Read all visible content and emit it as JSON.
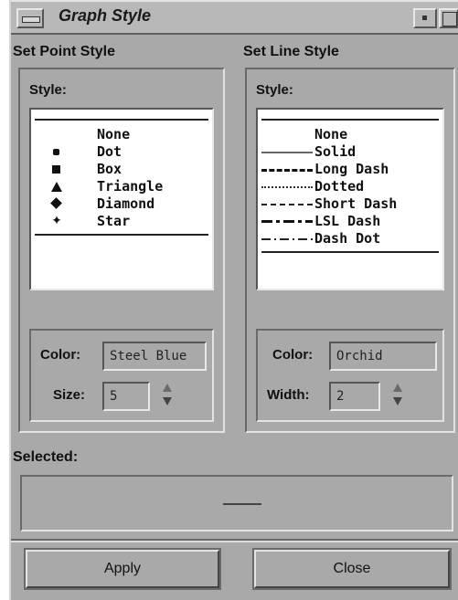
{
  "window": {
    "title": "Graph Style"
  },
  "point_section": {
    "heading": "Set Point Style",
    "style_label": "Style:",
    "items": [
      {
        "label": "None",
        "symbol": "none"
      },
      {
        "label": "Dot",
        "symbol": "dot"
      },
      {
        "label": "Box",
        "symbol": "box"
      },
      {
        "label": "Triangle",
        "symbol": "triangle"
      },
      {
        "label": "Diamond",
        "symbol": "diamond"
      },
      {
        "label": "Star",
        "symbol": "star"
      }
    ],
    "color_label": "Color:",
    "color_value": "Steel Blue",
    "size_label": "Size:",
    "size_value": "5"
  },
  "line_section": {
    "heading": "Set Line Style",
    "style_label": "Style:",
    "items": [
      {
        "label": "None",
        "symbol": "none"
      },
      {
        "label": "Solid",
        "symbol": "solid"
      },
      {
        "label": "Long Dash",
        "symbol": "long-dash"
      },
      {
        "label": "Dotted",
        "symbol": "dotted"
      },
      {
        "label": "Short Dash",
        "symbol": "short-dash"
      },
      {
        "label": "LSL Dash",
        "symbol": "lsl-dash"
      },
      {
        "label": "Dash Dot",
        "symbol": "dash-dot"
      }
    ],
    "color_label": "Color:",
    "color_value": "Orchid",
    "width_label": "Width:",
    "width_value": "2"
  },
  "selected": {
    "label": "Selected:"
  },
  "buttons": {
    "apply": "Apply",
    "close": "Close"
  },
  "colors": {
    "window_bg": "#a9a9a9",
    "list_bg": "#ffffff"
  }
}
